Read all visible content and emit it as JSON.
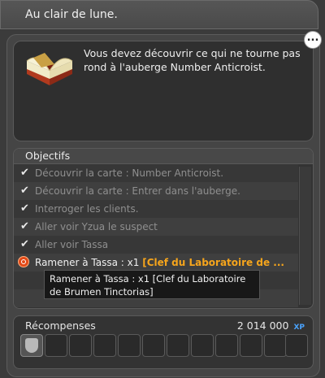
{
  "window": {
    "title": "Au clair de lune."
  },
  "description": {
    "text": "Vous devez découvrir ce qui ne tourne pas rond à l'auberge Number Anticroist.",
    "icon": "open-book-icon"
  },
  "chat_button": {
    "icon": "speech-bubble-icon",
    "label": "..."
  },
  "objectives": {
    "header": "Objectifs",
    "items": [
      {
        "label": "Découvrir la carte : Number Anticroist.",
        "status": "done"
      },
      {
        "label": "Découvrir la carte : Entrer dans l'auberge.",
        "status": "done"
      },
      {
        "label": "Interroger les clients.",
        "status": "done"
      },
      {
        "label": "Aller voir Yzua le suspect",
        "status": "done"
      },
      {
        "label": "Aller voir Tassa",
        "status": "done"
      },
      {
        "label": "Ramener à Tassa : x1",
        "item": "[Clef du Laboratoire de ...",
        "status": "active"
      }
    ]
  },
  "tooltip": {
    "text": "Ramener à Tassa : x1 [Clef du Laboratoire de Brumen Tinctorias]"
  },
  "rewards": {
    "label": "Récompenses",
    "xp_value": "2 014 000",
    "xp_unit": "XP",
    "slots": [
      {
        "filled": true,
        "icon": "emblem-icon"
      },
      {
        "filled": false
      },
      {
        "filled": false
      },
      {
        "filled": false
      },
      {
        "filled": false
      },
      {
        "filled": false
      },
      {
        "filled": false
      },
      {
        "filled": false
      },
      {
        "filled": false
      },
      {
        "filled": false
      },
      {
        "filled": false
      },
      {
        "filled": false
      }
    ]
  }
}
